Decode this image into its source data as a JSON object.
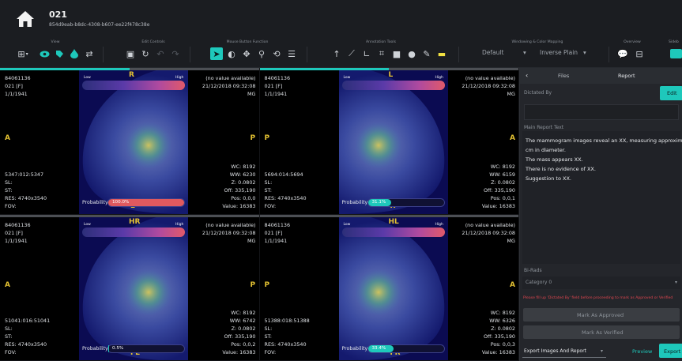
{
  "header": {
    "study_id": "021",
    "study_uid": "854d9eab-b8dc-4308-b607-ee22f478c38e"
  },
  "toolbar": {
    "groups": {
      "view": "View",
      "edit": "Edit Controls",
      "mouse": "Mouse Button Function",
      "annotation": "Annotation Tools",
      "windowing": "Windowing & Color Mapping",
      "overview": "Overview",
      "sidebar": "Sideb"
    },
    "windowing_preset": "Default",
    "color_map": "Inverse Plain",
    "accent": "#1ec8bb"
  },
  "viewports": [
    {
      "laterality": "R",
      "bottom": "L",
      "left_marker": "A",
      "right_marker": "P",
      "tl": [
        "84061136",
        "021 [F]",
        "1/1/1941"
      ],
      "tr": [
        "(no value available)",
        "21/12/2018 09:32:08",
        "MG"
      ],
      "bl": [
        "5347:012:5347",
        "SL:",
        "ST:",
        "RES: 4740x3540",
        "FOV:"
      ],
      "br": [
        "WC: 8192",
        "WW: 6230",
        "Z: 0.0802",
        "Off: 335,190",
        "Pos: 0,0,0",
        "Value: 16383"
      ],
      "probability_label": "Probability",
      "probability": "100.0%",
      "probability_value": 1.0,
      "prob_color": "#e0595f",
      "cbar_low": "Low",
      "cbar_high": "High"
    },
    {
      "laterality": "L",
      "bottom": "R",
      "left_marker": "P",
      "right_marker": "A",
      "tl": [
        "84061136",
        "021 [F]",
        "1/1/1941"
      ],
      "tr": [
        "(no value available)",
        "21/12/2018 09:32:08",
        "MG"
      ],
      "bl": [
        "5694:014:5694",
        "SL:",
        "ST:",
        "RES: 4740x3540",
        "FOV:"
      ],
      "br": [
        "WC: 8192",
        "WW: 6159",
        "Z: 0.0802",
        "Off: 335,190",
        "Pos: 0,0,1",
        "Value: 16383"
      ],
      "probability_label": "Probability",
      "probability": "31.1%",
      "probability_value": 0.311,
      "prob_color": "#1ec8bb",
      "cbar_low": "Low",
      "cbar_high": "High"
    },
    {
      "laterality": "HR",
      "bottom": "FL",
      "left_marker": "A",
      "right_marker": "P",
      "tl": [
        "84061136",
        "021 [F]",
        "1/1/1941"
      ],
      "tr": [
        "(no value available)",
        "21/12/2018 09:32:08",
        "MG"
      ],
      "bl": [
        "51041:016:51041",
        "SL:",
        "ST:",
        "RES: 4740x3540",
        "FOV:"
      ],
      "br": [
        "WC: 8192",
        "WW: 6742",
        "Z: 0.0802",
        "Off: 335,190",
        "Pos: 0,0,2",
        "Value: 16383"
      ],
      "probability_label": "Probability",
      "probability": "0.5%",
      "probability_value": 0.005,
      "prob_color": "#1ec8bb",
      "cbar_low": "Low",
      "cbar_high": "High"
    },
    {
      "laterality": "HL",
      "bottom": "FR",
      "left_marker": "P",
      "right_marker": "A",
      "tl": [
        "84061136",
        "021 [F]",
        "1/1/1941"
      ],
      "tr": [
        "(no value available)",
        "21/12/2018 09:32:08",
        "MG"
      ],
      "bl": [
        "51388:018:51388",
        "SL:",
        "ST:",
        "RES: 4740x3540",
        "FOV:"
      ],
      "br": [
        "WC: 8192",
        "WW: 6326",
        "Z: 0.0802",
        "Off: 335,190",
        "Pos: 0,0,3",
        "Value: 16383"
      ],
      "probability_label": "Probability",
      "probability": "33.4%",
      "probability_value": 0.334,
      "prob_color": "#1ec8bb",
      "cbar_low": "Low",
      "cbar_high": "High"
    }
  ],
  "panel": {
    "tab_files": "Files",
    "tab_report": "Report",
    "dictated_by_label": "Dictated By",
    "edit_button": "Edit",
    "main_report_label": "Main Report Text",
    "report_lines": [
      "The mammogram images reveal an XX, measuring approximately XX",
      "cm in diameter.",
      "The mass appears XX.",
      "There is no evidence of XX.",
      "Suggestion to XX."
    ],
    "birads_label": "Bi-Rads",
    "birads_value": "Category 0",
    "warning": "Please fill up 'Dictated By' field before proceeding to mark as Approved or Verified",
    "approve_button": "Mark As Approved",
    "verify_button": "Mark As Verified",
    "export_option": "Export Images And Report",
    "preview_button": "Preview",
    "export_button": "Export",
    "warning_color": "#e0464f"
  }
}
